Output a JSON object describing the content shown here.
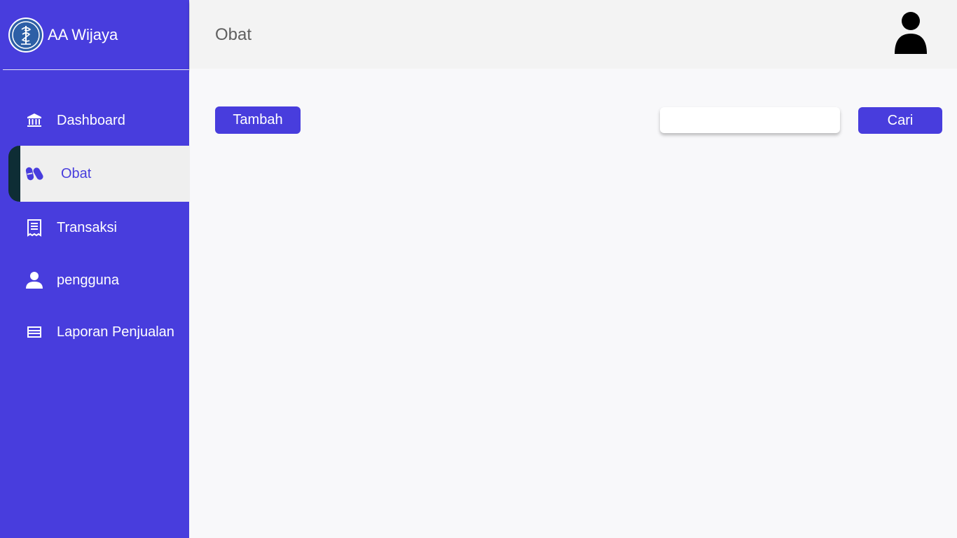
{
  "brand": {
    "name": "AA Wijaya",
    "logo_icon": "caduceus-icon"
  },
  "colors": {
    "primary": "#483ddd",
    "active_bg": "#efefef",
    "active_marker": "#0e2d35"
  },
  "sidebar": {
    "items": [
      {
        "label": "Dashboard",
        "icon": "bank-icon",
        "active": false
      },
      {
        "label": "Obat",
        "icon": "pills-icon",
        "active": true
      },
      {
        "label": "Transaksi",
        "icon": "receipt-icon",
        "active": false
      },
      {
        "label": "pengguna",
        "icon": "user-icon",
        "active": false
      },
      {
        "label": "Laporan Penjualan",
        "icon": "report-icon",
        "active": false
      }
    ]
  },
  "header": {
    "title": "Obat",
    "avatar_icon": "user-avatar-icon"
  },
  "toolbar": {
    "add_label": "Tambah",
    "search_value": "",
    "search_placeholder": "",
    "search_label": "Cari"
  }
}
